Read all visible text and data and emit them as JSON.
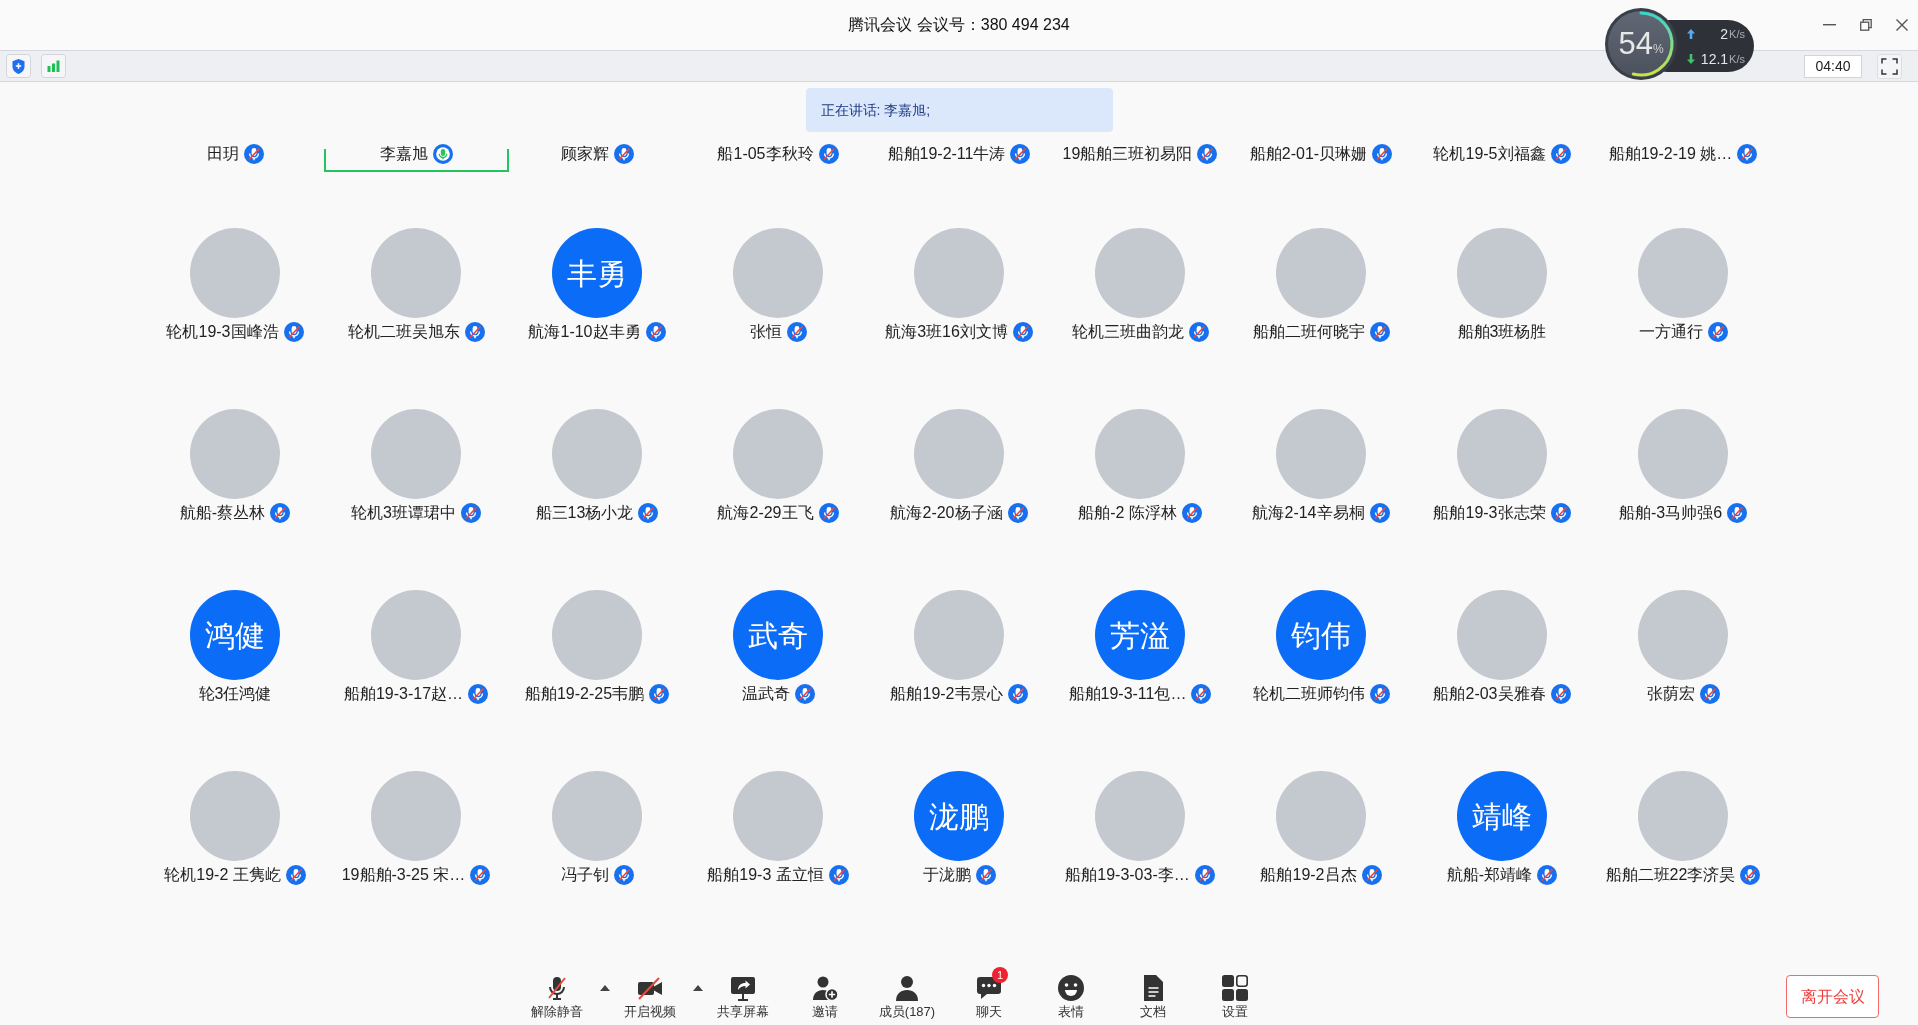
{
  "window": {
    "title": "腾讯会议 会议号：380 494 234"
  },
  "toolbar": {
    "timer": "04:40"
  },
  "network_monitor": {
    "value": "54",
    "unit": "%",
    "level": 0.54,
    "upload": {
      "value": "2",
      "unit": "K/s"
    },
    "download": {
      "value": "12.1",
      "unit": "K/s"
    }
  },
  "speaking_banner": "正在讲话: 李嘉旭;",
  "participant_grid": {
    "cut_off_row": [
      {
        "name": "田玥",
        "muted": true,
        "speaking": false
      },
      {
        "name": "李嘉旭",
        "muted": false,
        "speaking": true
      },
      {
        "name": "顾家辉",
        "muted": true,
        "speaking": false
      },
      {
        "name": "船1-05李秋玲",
        "muted": true,
        "speaking": false
      },
      {
        "name": "船舶19-2-11牛涛",
        "muted": true,
        "speaking": false
      },
      {
        "name": "19船舶三班初易阳",
        "muted": true,
        "speaking": false
      },
      {
        "name": "船舶2-01-贝琳姗",
        "muted": true,
        "speaking": false
      },
      {
        "name": "轮机19-5刘福鑫",
        "muted": true,
        "speaking": false
      },
      {
        "name": "船舶19-2-19 姚…",
        "muted": true,
        "speaking": false
      }
    ],
    "tiles": [
      {
        "name": "轮机19-3国峰浩",
        "avatar": {
          "kind": "photo"
        },
        "muted": true,
        "speaking": false
      },
      {
        "name": "轮机二班吴旭东",
        "avatar": {
          "kind": "photo"
        },
        "muted": true,
        "speaking": false
      },
      {
        "name": "航海1-10赵丰勇",
        "avatar": {
          "kind": "initials",
          "text": "丰勇"
        },
        "muted": true,
        "speaking": false
      },
      {
        "name": "张恒",
        "avatar": {
          "kind": "photo"
        },
        "muted": true,
        "speaking": false
      },
      {
        "name": "航海3班16刘文博",
        "avatar": {
          "kind": "photo"
        },
        "muted": true,
        "speaking": false
      },
      {
        "name": "轮机三班曲韵龙",
        "avatar": {
          "kind": "photo"
        },
        "muted": true,
        "speaking": false
      },
      {
        "name": "船舶二班何晓宇",
        "avatar": {
          "kind": "photo"
        },
        "muted": true,
        "speaking": false
      },
      {
        "name": "船舶3班杨胜",
        "avatar": {
          "kind": "photo"
        },
        "muted": false,
        "speaking": false
      },
      {
        "name": "一方通行",
        "avatar": {
          "kind": "photo"
        },
        "muted": true,
        "speaking": false
      },
      {
        "name": "航船-蔡丛林",
        "avatar": {
          "kind": "photo"
        },
        "muted": true,
        "speaking": false
      },
      {
        "name": "轮机3班谭珺中",
        "avatar": {
          "kind": "photo"
        },
        "muted": true,
        "speaking": false
      },
      {
        "name": "船三13杨小龙",
        "avatar": {
          "kind": "photo"
        },
        "muted": true,
        "speaking": false
      },
      {
        "name": "航海2-29王飞",
        "avatar": {
          "kind": "photo"
        },
        "muted": true,
        "speaking": false
      },
      {
        "name": "航海2-20杨子涵",
        "avatar": {
          "kind": "photo"
        },
        "muted": true,
        "speaking": false
      },
      {
        "name": "船舶-2 陈浮林",
        "avatar": {
          "kind": "photo"
        },
        "muted": true,
        "speaking": false
      },
      {
        "name": "航海2-14辛易桐",
        "avatar": {
          "kind": "photo"
        },
        "muted": true,
        "speaking": false
      },
      {
        "name": "船舶19-3张志荣",
        "avatar": {
          "kind": "photo"
        },
        "muted": true,
        "speaking": false
      },
      {
        "name": "船舶-3马帅强6",
        "avatar": {
          "kind": "photo"
        },
        "muted": true,
        "speaking": false
      },
      {
        "name": "轮3任鸿健",
        "avatar": {
          "kind": "initials",
          "text": "鸿健"
        },
        "muted": false,
        "speaking": false
      },
      {
        "name": "船舶19-3-17赵…",
        "avatar": {
          "kind": "photo"
        },
        "muted": true,
        "speaking": false
      },
      {
        "name": "船舶19-2-25韦鹏",
        "avatar": {
          "kind": "photo"
        },
        "muted": true,
        "speaking": false
      },
      {
        "name": "温武奇",
        "avatar": {
          "kind": "initials",
          "text": "武奇"
        },
        "muted": true,
        "speaking": false
      },
      {
        "name": "船舶19-2韦景心",
        "avatar": {
          "kind": "photo"
        },
        "muted": true,
        "speaking": false
      },
      {
        "name": "船舶19-3-11包…",
        "avatar": {
          "kind": "initials",
          "text": "芳溢"
        },
        "muted": true,
        "speaking": false
      },
      {
        "name": "轮机二班师钧伟",
        "avatar": {
          "kind": "initials",
          "text": "钧伟"
        },
        "muted": true,
        "speaking": false
      },
      {
        "name": "船舶2-03吴雅春",
        "avatar": {
          "kind": "photo"
        },
        "muted": true,
        "speaking": false
      },
      {
        "name": "张荫宏",
        "avatar": {
          "kind": "photo"
        },
        "muted": true,
        "speaking": false
      },
      {
        "name": "轮机19-2 王隽屹",
        "avatar": {
          "kind": "photo"
        },
        "muted": true,
        "speaking": false
      },
      {
        "name": "19船舶-3-25 宋…",
        "avatar": {
          "kind": "photo"
        },
        "muted": true,
        "speaking": false
      },
      {
        "name": "冯子钊",
        "avatar": {
          "kind": "photo"
        },
        "muted": true,
        "speaking": false
      },
      {
        "name": "船舶19-3 孟立恒",
        "avatar": {
          "kind": "photo"
        },
        "muted": true,
        "speaking": false
      },
      {
        "name": "于泷鹏",
        "avatar": {
          "kind": "initials",
          "text": "泷鹏"
        },
        "muted": true,
        "speaking": false
      },
      {
        "name": "船舶19-3-03-李…",
        "avatar": {
          "kind": "photo"
        },
        "muted": true,
        "speaking": false
      },
      {
        "name": "船舶19-2吕杰",
        "avatar": {
          "kind": "photo"
        },
        "muted": true,
        "speaking": false
      },
      {
        "name": "航船-郑靖峰",
        "avatar": {
          "kind": "initials",
          "text": "靖峰"
        },
        "muted": true,
        "speaking": false
      },
      {
        "name": "船舶二班22李济昊",
        "avatar": {
          "kind": "photo"
        },
        "muted": true,
        "speaking": false
      }
    ]
  },
  "bottom_bar": {
    "buttons": [
      {
        "kind": "unmute",
        "label": "解除静音",
        "menu_caret": true
      },
      {
        "kind": "video",
        "label": "开启视频",
        "menu_caret": true
      },
      {
        "kind": "share",
        "label": "共享屏幕",
        "menu_caret": false
      },
      {
        "kind": "invite",
        "label": "邀请",
        "menu_caret": false
      },
      {
        "kind": "members",
        "label": "成员(187)",
        "menu_caret": false
      },
      {
        "kind": "chat",
        "label": "聊天",
        "badge": "1",
        "menu_caret": false
      },
      {
        "kind": "reactions",
        "label": "表情",
        "menu_caret": false
      },
      {
        "kind": "documents",
        "label": "文档",
        "menu_caret": false
      },
      {
        "kind": "settings",
        "label": "设置",
        "menu_caret": false
      }
    ],
    "leave_button": "离开会议"
  }
}
